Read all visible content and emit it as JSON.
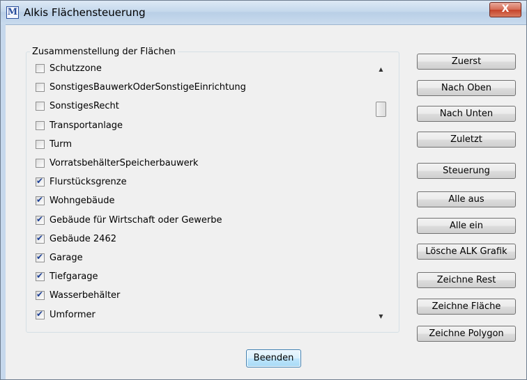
{
  "window": {
    "title": "Alkis Flächensteuerung",
    "close_label": "X"
  },
  "group": {
    "label": "Zusammenstellung der Flächen"
  },
  "list": {
    "items": [
      {
        "label": "Schutzzone",
        "checked": false
      },
      {
        "label": "SonstigesBauwerkOderSonstigeEinrichtung",
        "checked": false
      },
      {
        "label": "SonstigesRecht",
        "checked": false
      },
      {
        "label": "Transportanlage",
        "checked": false
      },
      {
        "label": "Turm",
        "checked": false
      },
      {
        "label": "VorratsbehälterSpeicherbauwerk",
        "checked": false
      },
      {
        "label": "Flurstücksgrenze",
        "checked": true
      },
      {
        "label": "Wohngebäude",
        "checked": true
      },
      {
        "label": "Gebäude für Wirtschaft oder Gewerbe",
        "checked": true
      },
      {
        "label": "Gebäude 2462",
        "checked": true
      },
      {
        "label": "Garage",
        "checked": true
      },
      {
        "label": "Tiefgarage",
        "checked": true
      },
      {
        "label": "Wasserbehälter",
        "checked": true
      },
      {
        "label": "Umformer",
        "checked": true
      }
    ],
    "scroll_up_icon": "triangle-up",
    "scroll_down_icon": "triangle-down"
  },
  "buttons": {
    "first": "Zuerst",
    "up": "Nach Oben",
    "down": "Nach Unten",
    "last": "Zuletzt",
    "control": "Steuerung",
    "all_off": "Alle aus",
    "all_on": "Alle ein",
    "delete_alk": "Lösche ALK Grafik",
    "draw_rest": "Zeichne Rest",
    "draw_area": "Zeichne Fläche",
    "draw_polygon": "Zeichne Polygon",
    "quit": "Beenden"
  },
  "colors": {
    "check": "#1c3f94",
    "close_button": "#c5432a",
    "default_button_border": "#3c7fb1"
  }
}
